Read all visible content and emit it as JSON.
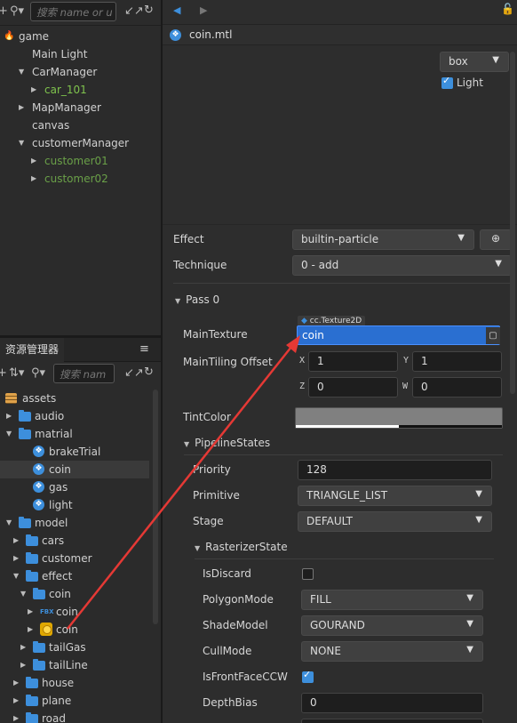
{
  "hierarchy": {
    "search_placeholder": "搜索 name or u",
    "nodes": [
      {
        "label": "game",
        "indent": 0,
        "arrow": "",
        "icon": "flame-icon"
      },
      {
        "label": "Main Light",
        "indent": 1,
        "arrow": ""
      },
      {
        "label": "CarManager",
        "indent": 1,
        "arrow": "down"
      },
      {
        "label": "car_101",
        "indent": 2,
        "arrow": "right",
        "color": "green"
      },
      {
        "label": "MapManager",
        "indent": 1,
        "arrow": "right"
      },
      {
        "label": "canvas",
        "indent": 1,
        "arrow": ""
      },
      {
        "label": "customerManager",
        "indent": 1,
        "arrow": "down"
      },
      {
        "label": "customer01",
        "indent": 2,
        "arrow": "right",
        "color": "green-dim"
      },
      {
        "label": "customer02",
        "indent": 2,
        "arrow": "right",
        "color": "green-dim"
      }
    ]
  },
  "assets": {
    "tab_label": "资源管理器",
    "menu_icon": "≡",
    "search_placeholder": "搜索 nam",
    "items": [
      {
        "label": "assets",
        "indent": 0,
        "arrow": "",
        "icon": "db"
      },
      {
        "label": "audio",
        "indent": 1,
        "arrow": "right",
        "icon": "folder"
      },
      {
        "label": "matrial",
        "indent": 1,
        "arrow": "down",
        "icon": "folder"
      },
      {
        "label": "brakeTrial",
        "indent": 2,
        "arrow": "",
        "icon": "mtl"
      },
      {
        "label": "coin",
        "indent": 2,
        "arrow": "",
        "icon": "mtl",
        "selected": true
      },
      {
        "label": "gas",
        "indent": 2,
        "arrow": "",
        "icon": "mtl"
      },
      {
        "label": "light",
        "indent": 2,
        "arrow": "",
        "icon": "mtl"
      },
      {
        "label": "model",
        "indent": 1,
        "arrow": "down",
        "icon": "folder"
      },
      {
        "label": "cars",
        "indent": 2,
        "arrow": "right",
        "icon": "folder"
      },
      {
        "label": "customer",
        "indent": 2,
        "arrow": "right",
        "icon": "folder"
      },
      {
        "label": "effect",
        "indent": 2,
        "arrow": "down",
        "icon": "folder"
      },
      {
        "label": "coin",
        "indent": 3,
        "arrow": "down",
        "icon": "folder"
      },
      {
        "label": "coin",
        "indent": 4,
        "arrow": "right",
        "icon": "fbx"
      },
      {
        "label": "coin",
        "indent": 4,
        "arrow": "right",
        "icon": "coin"
      },
      {
        "label": "tailGas",
        "indent": 3,
        "arrow": "right",
        "icon": "folder"
      },
      {
        "label": "tailLine",
        "indent": 3,
        "arrow": "right",
        "icon": "folder"
      },
      {
        "label": "house",
        "indent": 2,
        "arrow": "right",
        "icon": "folder"
      },
      {
        "label": "plane",
        "indent": 2,
        "arrow": "right",
        "icon": "folder"
      },
      {
        "label": "road",
        "indent": 2,
        "arrow": "right",
        "icon": "folder"
      }
    ]
  },
  "inspector": {
    "title": "coin.mtl",
    "preview": {
      "shape": "box",
      "light_label": "Light",
      "light_checked": true
    },
    "effect": {
      "label": "Effect",
      "value": "builtin-particle"
    },
    "technique": {
      "label": "Technique",
      "value": "0 - add"
    },
    "pass": {
      "label": "Pass 0"
    },
    "main_texture": {
      "label": "MainTexture",
      "type_tag": "cc.Texture2D",
      "value": "coin"
    },
    "main_tiling": {
      "label": "MainTiling Offset",
      "x": "1",
      "y": "1",
      "z": "0",
      "w": "0",
      "x_label": "X",
      "y_label": "Y",
      "z_label": "Z",
      "w_label": "W"
    },
    "tint_color": {
      "label": "TintColor",
      "swatch": "#808080"
    },
    "pipeline": {
      "label": "PipelineStates",
      "priority": {
        "label": "Priority",
        "value": "128"
      },
      "primitive": {
        "label": "Primitive",
        "value": "TRIANGLE_LIST"
      },
      "stage": {
        "label": "Stage",
        "value": "DEFAULT"
      },
      "rasterizer": {
        "label": "RasterizerState",
        "is_discard": {
          "label": "IsDiscard",
          "checked": false
        },
        "polygon_mode": {
          "label": "PolygonMode",
          "value": "FILL"
        },
        "shade_model": {
          "label": "ShadeModel",
          "value": "GOURAND"
        },
        "cull_mode": {
          "label": "CullMode",
          "value": "NONE"
        },
        "front_face_ccw": {
          "label": "IsFrontFaceCCW",
          "checked": true
        },
        "depth_bias": {
          "label": "DepthBias",
          "value": "0"
        }
      }
    }
  },
  "colors": {
    "accent": "#3d8fdc",
    "selection": "#2a6fd1",
    "annotation": "#e53935"
  }
}
